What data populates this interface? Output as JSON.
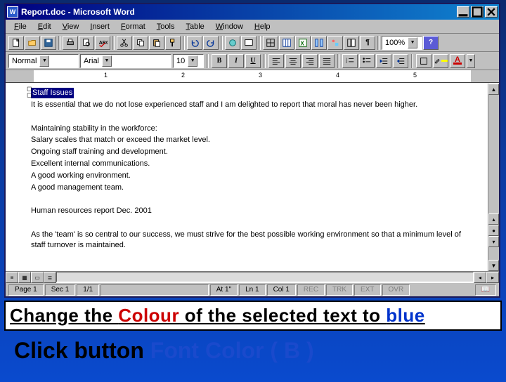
{
  "titlebar": {
    "app_icon_text": "W",
    "title": "Report.doc - Microsoft Word"
  },
  "menus": [
    "File",
    "Edit",
    "View",
    "Insert",
    "Format",
    "Tools",
    "Table",
    "Window",
    "Help"
  ],
  "toolbar": {
    "zoom": "100%"
  },
  "formatbar": {
    "style": "Normal",
    "font": "Arial",
    "size": "10",
    "bold": "B",
    "italic": "I",
    "underline": "U",
    "font_color_letter": "A"
  },
  "ruler": {
    "ticks": [
      "1",
      "2",
      "3",
      "4",
      "5"
    ]
  },
  "document": {
    "selected_heading": "Staff Issues",
    "para1": "It is essential that we do not lose experienced staff and I am delighted to report that moral has never been higher.",
    "list_heading": "Maintaining stability in the workforce:",
    "list": [
      "Salary scales that match or exceed the market level.",
      "Ongoing staff training and development.",
      "Excellent internal communications.",
      "A good working environment.",
      "A good management team."
    ],
    "hr_line": "Human resources report Dec. 2001",
    "para2": "As the 'team' is so central to our success, we must strive for the best possible working environment so that a minimum level of staff turnover is maintained."
  },
  "statusbar": {
    "page": "Page 1",
    "sec": "Sec 1",
    "pages": "1/1",
    "at": "At 1\"",
    "ln": "Ln 1",
    "col": "Col 1",
    "rec": "REC",
    "trk": "TRK",
    "ext": "EXT",
    "ovr": "OVR"
  },
  "instruction1": {
    "pre": "Change the ",
    "colour": "Colour",
    "mid": " of the selected text to ",
    "blue": "blue"
  },
  "instruction2": {
    "pre": "Click button ",
    "action": "Font Color ( B )"
  }
}
